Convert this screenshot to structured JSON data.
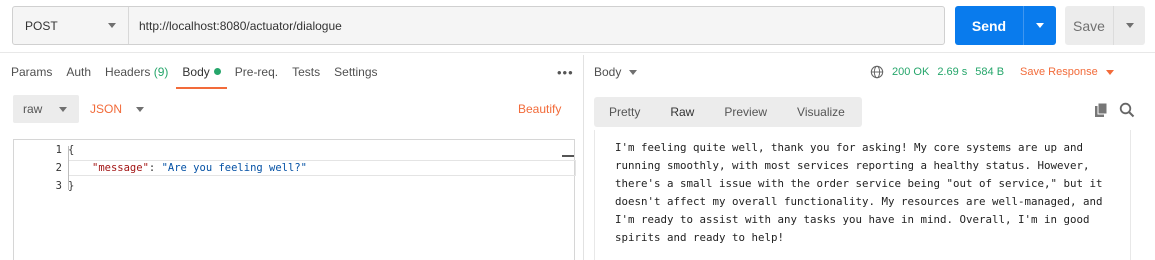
{
  "request": {
    "method": "POST",
    "url": "http://localhost:8080/actuator/dialogue",
    "send_label": "Send",
    "save_label": "Save"
  },
  "request_tabs": [
    {
      "label": "Params"
    },
    {
      "label": "Auth"
    },
    {
      "label": "Headers",
      "count": "(9)"
    },
    {
      "label": "Body"
    },
    {
      "label": "Pre-req."
    },
    {
      "label": "Tests"
    },
    {
      "label": "Settings"
    }
  ],
  "more_label": "•••",
  "body_mode": "raw",
  "body_format": "JSON",
  "beautify_label": "Beautify",
  "editor": {
    "line_numbers": [
      "1",
      "2",
      "3"
    ],
    "line1": "{",
    "key": "\"message\"",
    "colon": ": ",
    "value": "\"Are you feeling well?\"",
    "line3": "}"
  },
  "response": {
    "body_label": "Body",
    "status": "200 OK",
    "time": "2.69 s",
    "size": "584 B",
    "save_response_label": "Save Response",
    "view_tabs": [
      "Pretty",
      "Raw",
      "Preview",
      "Visualize"
    ],
    "text": "I'm feeling quite well, thank you for asking! My core systems are up and running smoothly, with most services reporting a healthy status. However, there's a small issue with the order service being \"out of service,\" but it doesn't affect my overall functionality. My resources are well-managed, and I'm ready to assist with any tasks you have in mind. Overall, I'm in good spirits and ready to help!"
  },
  "colors": {
    "accent": "#f26b3a",
    "send": "#097bed",
    "success": "#26a66b"
  }
}
